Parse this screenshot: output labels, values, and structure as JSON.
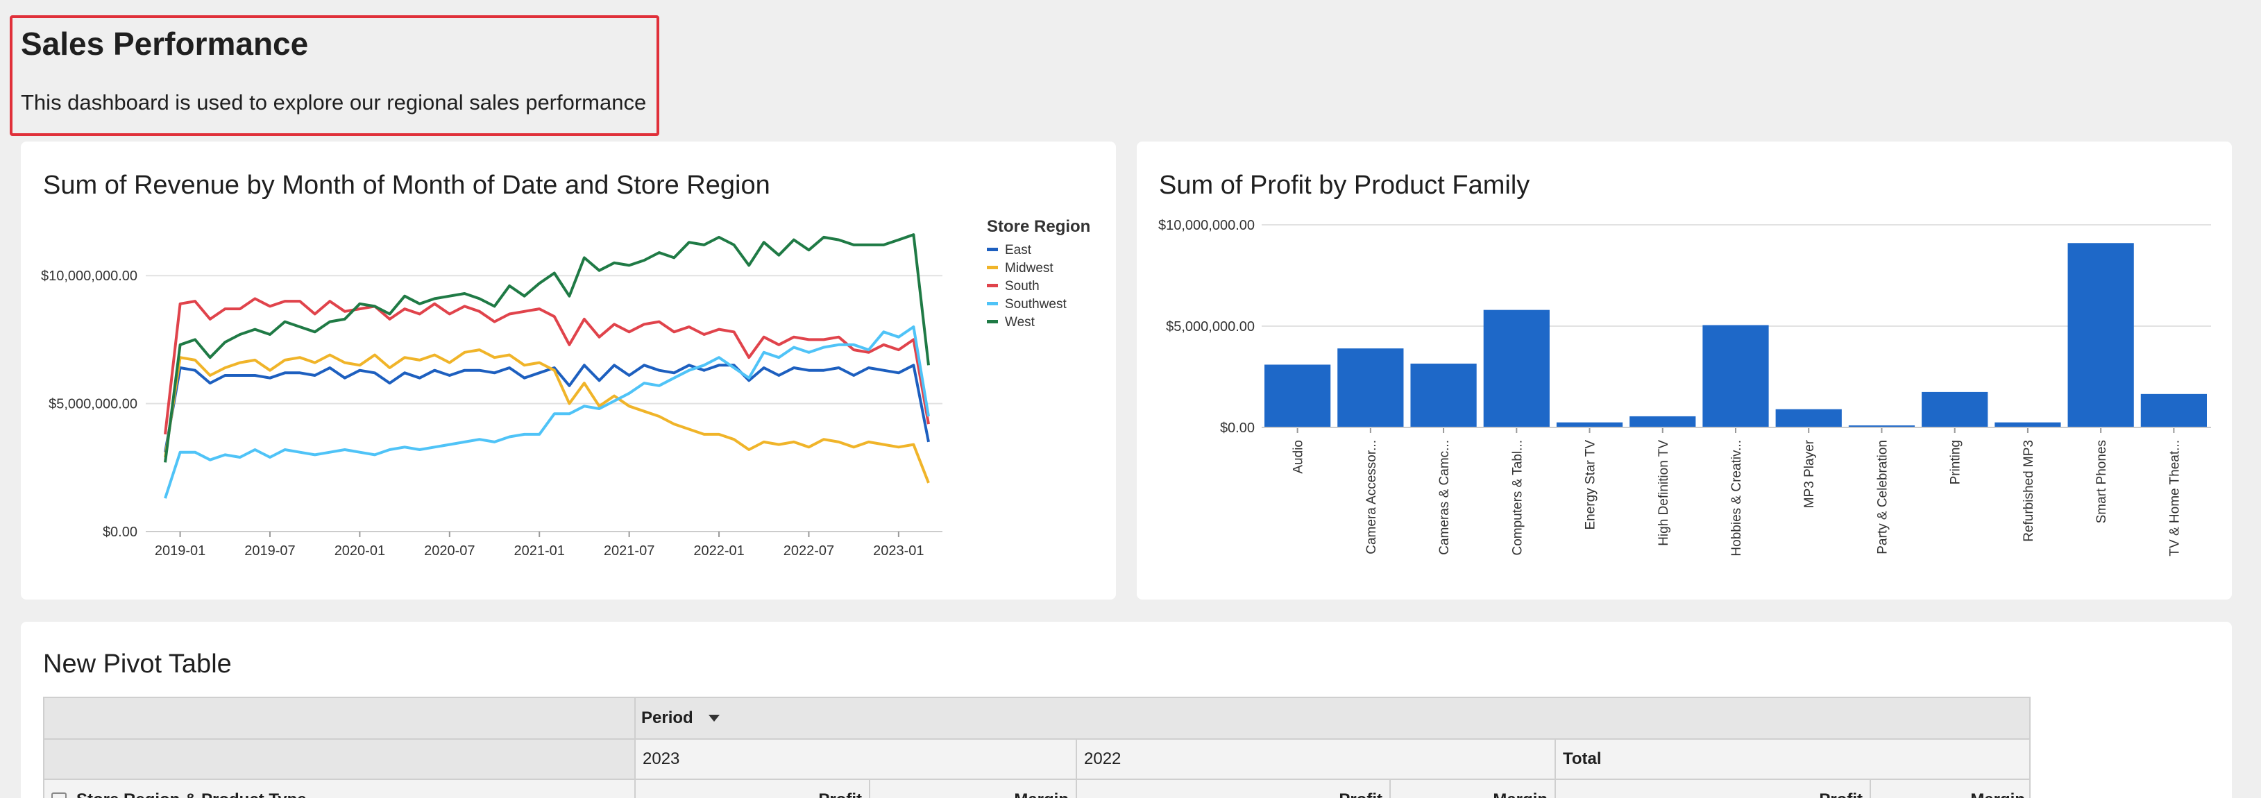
{
  "header": {
    "title": "Sales Performance",
    "description": "This dashboard is used to explore our regional sales performance"
  },
  "colors": {
    "east": "#1d5fbf",
    "midwest": "#f0b429",
    "south": "#e0434b",
    "southwest": "#4fc3f7",
    "west": "#1f7a45",
    "bar": "#1e68c8",
    "highlight": "#e0303a"
  },
  "line_chart": {
    "title": "Sum of Revenue by Month of Month of Date and Store Region",
    "legend_title": "Store Region"
  },
  "bar_chart": {
    "title": "Sum of Profit by Product Family"
  },
  "pivot": {
    "title": "New Pivot Table",
    "column_field": "Period",
    "periods": [
      "2023",
      "2022",
      "Total"
    ],
    "row_header": "Store Region & Product Type",
    "measure_profit": "Profit",
    "measure_margin": "Margin"
  },
  "chart_data": [
    {
      "type": "line",
      "title": "Sum of Revenue by Month of Month of Date and Store Region",
      "legend_title": "Store Region",
      "legend_position": "top-right",
      "x_start": "2018-12",
      "x_interval": "month",
      "x_ticks": [
        "2019-01",
        "2019-07",
        "2020-01",
        "2020-07",
        "2021-01",
        "2021-07",
        "2022-01",
        "2022-07",
        "2023-01"
      ],
      "y_ticks": [
        "$0.00",
        "$5,000,000.00",
        "$10,000,000.00"
      ],
      "ylim": [
        0,
        10900000
      ],
      "grid": true,
      "series": [
        {
          "name": "East",
          "color": "#1d5fbf",
          "values": [
            3100000,
            6400000,
            6300000,
            5800000,
            6100000,
            6100000,
            6100000,
            6000000,
            6200000,
            6200000,
            6100000,
            6400000,
            6000000,
            6300000,
            6200000,
            5800000,
            6200000,
            6000000,
            6300000,
            6100000,
            6300000,
            6300000,
            6200000,
            6400000,
            6000000,
            6200000,
            6400000,
            5700000,
            6500000,
            5900000,
            6500000,
            6100000,
            6500000,
            6300000,
            6200000,
            6500000,
            6300000,
            6500000,
            6500000,
            5900000,
            6400000,
            6100000,
            6400000,
            6300000,
            6300000,
            6400000,
            6100000,
            6400000,
            6300000,
            6200000,
            6500000,
            3500000
          ]
        },
        {
          "name": "Midwest",
          "color": "#f0b429",
          "values": [
            2900000,
            6800000,
            6700000,
            6100000,
            6400000,
            6600000,
            6700000,
            6300000,
            6700000,
            6800000,
            6600000,
            6900000,
            6600000,
            6500000,
            6900000,
            6400000,
            6800000,
            6700000,
            6900000,
            6600000,
            7000000,
            7100000,
            6800000,
            6900000,
            6500000,
            6600000,
            6300000,
            5000000,
            5800000,
            4900000,
            5300000,
            4900000,
            4700000,
            4500000,
            4200000,
            4000000,
            3800000,
            3800000,
            3600000,
            3200000,
            3500000,
            3400000,
            3500000,
            3300000,
            3600000,
            3500000,
            3300000,
            3500000,
            3400000,
            3300000,
            3400000,
            1900000
          ]
        },
        {
          "name": "South",
          "color": "#e0434b",
          "values": [
            3800000,
            8900000,
            9000000,
            8300000,
            8700000,
            8700000,
            9100000,
            8800000,
            9000000,
            9000000,
            8500000,
            9000000,
            8600000,
            8700000,
            8800000,
            8300000,
            8700000,
            8500000,
            8900000,
            8500000,
            8800000,
            8600000,
            8200000,
            8500000,
            8600000,
            8700000,
            8400000,
            7300000,
            8300000,
            7600000,
            8100000,
            7800000,
            8100000,
            8200000,
            7800000,
            8000000,
            7700000,
            7900000,
            7800000,
            6800000,
            7600000,
            7300000,
            7600000,
            7500000,
            7500000,
            7600000,
            7100000,
            7000000,
            7300000,
            7100000,
            7500000,
            4200000
          ]
        },
        {
          "name": "Southwest",
          "color": "#4fc3f7",
          "values": [
            1300000,
            3100000,
            3100000,
            2800000,
            3000000,
            2900000,
            3200000,
            2900000,
            3200000,
            3100000,
            3000000,
            3100000,
            3200000,
            3100000,
            3000000,
            3200000,
            3300000,
            3200000,
            3300000,
            3400000,
            3500000,
            3600000,
            3500000,
            3700000,
            3800000,
            3800000,
            4600000,
            4600000,
            4900000,
            4800000,
            5100000,
            5400000,
            5800000,
            5700000,
            6000000,
            6300000,
            6500000,
            6800000,
            6400000,
            6000000,
            7000000,
            6800000,
            7200000,
            7000000,
            7200000,
            7300000,
            7300000,
            7100000,
            7800000,
            7600000,
            8000000,
            4500000
          ]
        },
        {
          "name": "West",
          "color": "#1f7a45",
          "values": [
            2700000,
            7300000,
            7500000,
            6800000,
            7400000,
            7700000,
            7900000,
            7700000,
            8200000,
            8000000,
            7800000,
            8200000,
            8300000,
            8900000,
            8800000,
            8500000,
            9200000,
            8900000,
            9100000,
            9200000,
            9300000,
            9100000,
            8800000,
            9600000,
            9200000,
            9700000,
            10100000,
            9200000,
            10700000,
            10200000,
            10500000,
            10400000,
            10600000,
            10900000,
            10700000,
            11300000,
            11200000,
            11500000,
            11200000,
            10400000,
            11300000,
            10800000,
            11400000,
            11000000,
            11500000,
            11400000,
            11200000,
            11200000,
            11200000,
            11400000,
            11600000,
            6500000
          ]
        }
      ]
    },
    {
      "type": "bar",
      "title": "Sum of Profit by Product Family",
      "categories": [
        "Audio",
        "Camera Accessor...",
        "Cameras & Camc...",
        "Computers & Tabl...",
        "Energy Star TV",
        "High Definition TV",
        "Hobbies & Creativ...",
        "MP3 Player",
        "Party & Celebration",
        "Printing",
        "Refurbished MP3",
        "Smart Phones",
        "TV & Home Theat..."
      ],
      "values": [
        3100000,
        3900000,
        3150000,
        5800000,
        250000,
        550000,
        5050000,
        900000,
        100000,
        1750000,
        250000,
        9100000,
        1650000
      ],
      "y_ticks": [
        "$0.00",
        "$5,000,000.00",
        "$10,000,000.00"
      ],
      "ylim": [
        0,
        10000000
      ],
      "grid": true
    }
  ]
}
